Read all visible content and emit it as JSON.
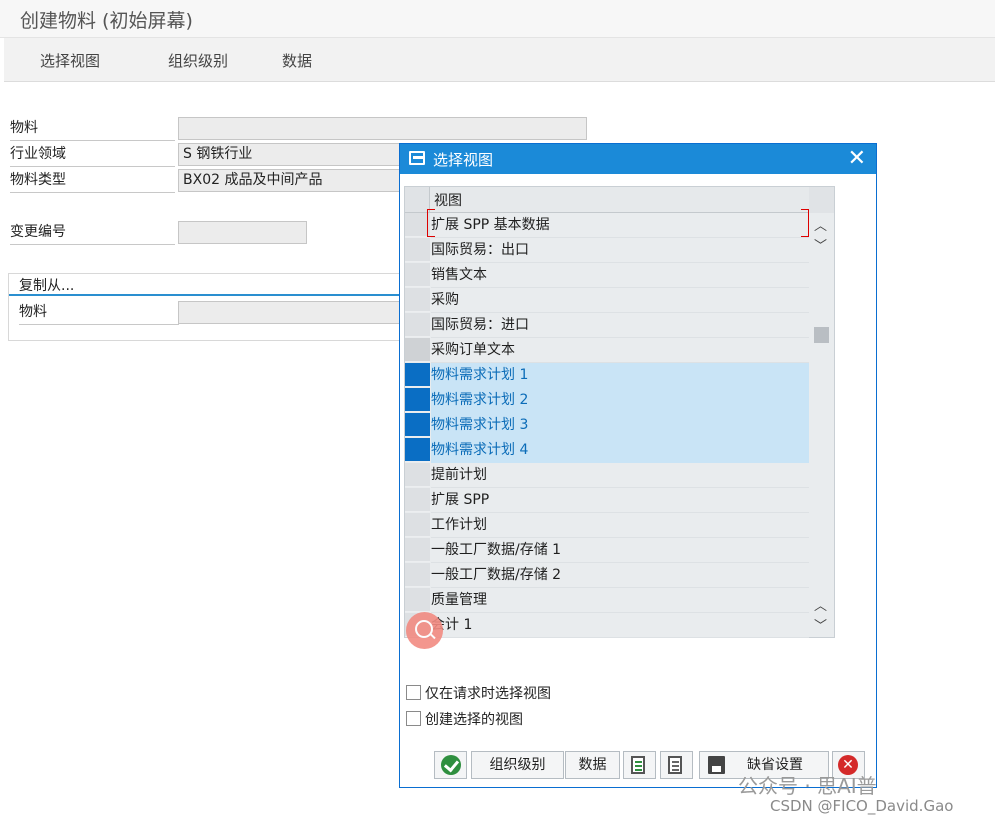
{
  "window": {
    "title": "创建物料 (初始屏幕)"
  },
  "toolbar": {
    "items": [
      "选择视图",
      "组织级别",
      "数据"
    ]
  },
  "form": {
    "material_label": "物料",
    "material_value": "",
    "industry_label": "行业领域",
    "industry_value": "S 钢铁行业",
    "type_label": "物料类型",
    "type_value": "BX02 成品及中间产品",
    "change_label": "变更编号",
    "change_value": "",
    "copy_group_title": "复制从...",
    "copy_material_label": "物料",
    "copy_material_value": ""
  },
  "dialog": {
    "title": "选择视图",
    "column_header": "视图",
    "rows": [
      "扩展 SPP 基本数据",
      "国际贸易：出口",
      "销售文本",
      "采购",
      "国际贸易：进口",
      "采购订单文本",
      "物料需求计划 1",
      "物料需求计划 2",
      "物料需求计划 3",
      "物料需求计划 4",
      "提前计划",
      "扩展 SPP",
      "工作计划",
      "一般工厂数据/存储 1",
      "一般工厂数据/存储 2",
      "质量管理",
      "会计 1"
    ],
    "selected_rows": [
      "物料需求计划 1",
      "物料需求计划 2",
      "物料需求计划 3",
      "物料需求计划 4"
    ],
    "checkbox_only_on_request": "仅在请求时选择视图",
    "checkbox_create_selected": "创建选择的视图",
    "buttons": {
      "org_levels": "组织级别",
      "data": "数据",
      "default_settings": "缺省设置"
    }
  },
  "watermark": {
    "line1": "公众号 · 思AI普",
    "line2": "CSDN @FICO_David.Gao"
  },
  "colors": {
    "dialog_header": "#1b8ad8",
    "selected_row": "#c9e4f6",
    "selected_marker": "#0a6ec4"
  }
}
